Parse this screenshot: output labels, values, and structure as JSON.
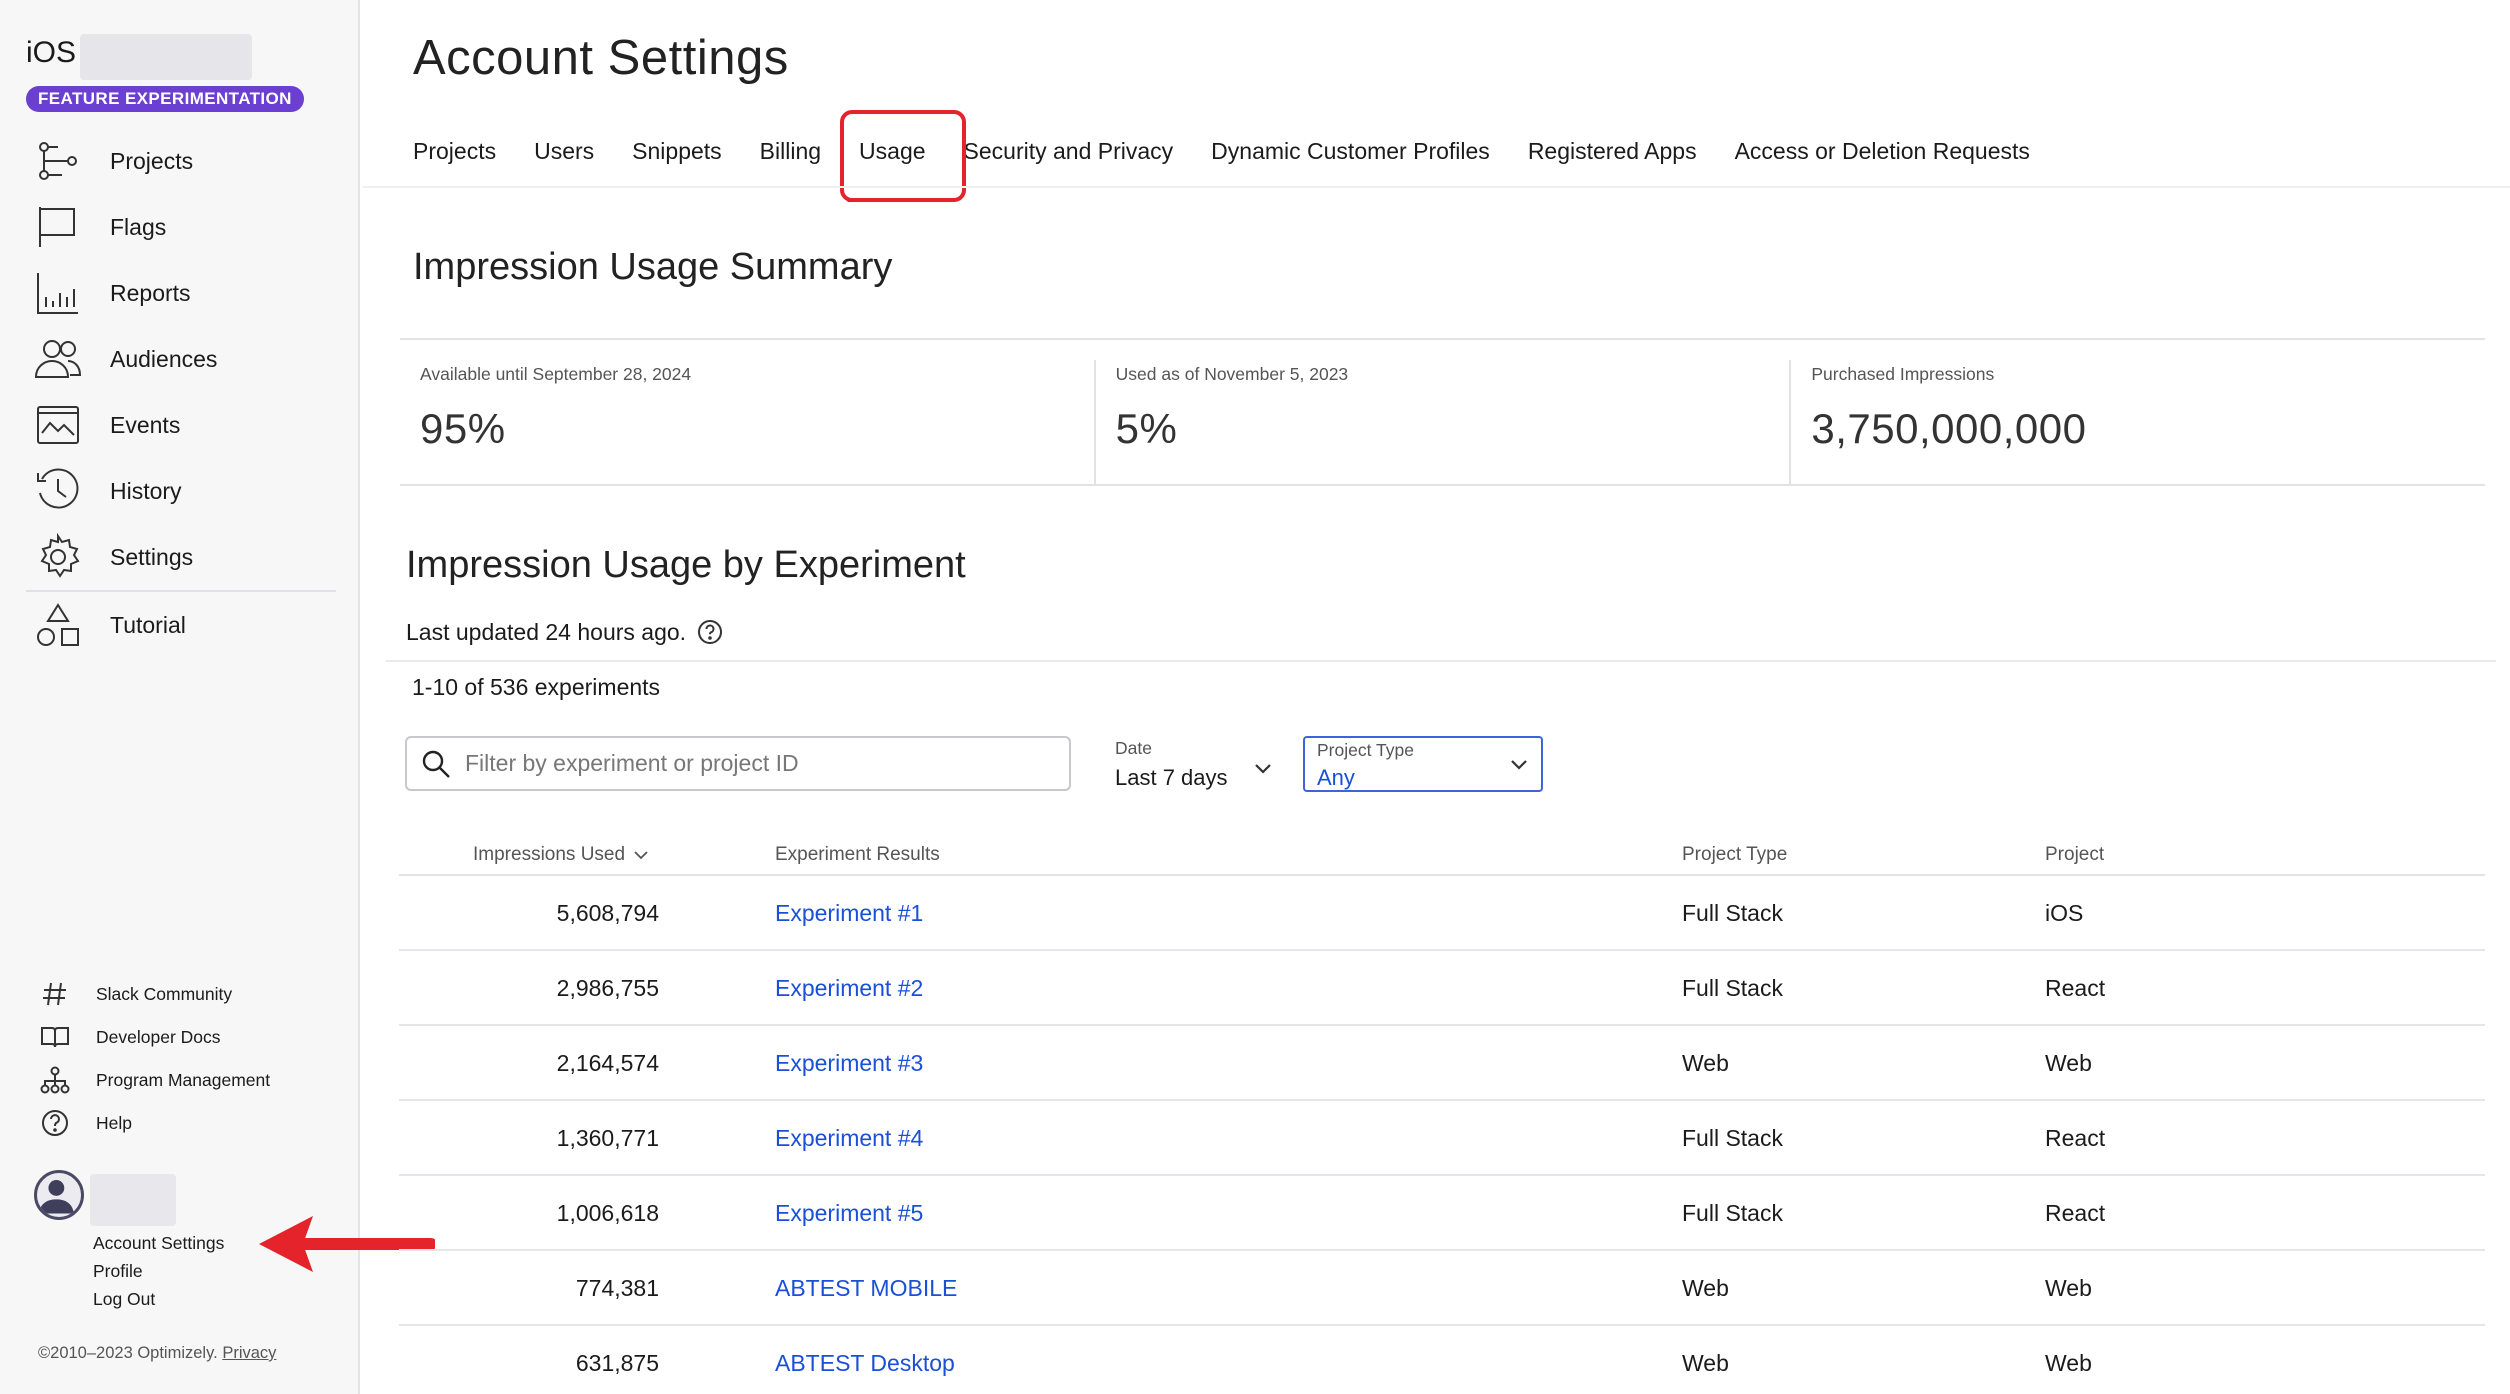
{
  "sidebar": {
    "project_name": "iOS",
    "badge": "FEATURE EXPERIMENTATION",
    "nav": [
      {
        "label": "Projects",
        "icon": "projects-icon"
      },
      {
        "label": "Flags",
        "icon": "flag-icon"
      },
      {
        "label": "Reports",
        "icon": "reports-icon"
      },
      {
        "label": "Audiences",
        "icon": "audiences-icon"
      },
      {
        "label": "Events",
        "icon": "events-icon"
      },
      {
        "label": "History",
        "icon": "history-icon"
      },
      {
        "label": "Settings",
        "icon": "gear-icon"
      },
      {
        "label": "Tutorial",
        "icon": "tutorial-icon"
      }
    ],
    "footer_links": [
      {
        "label": "Slack Community",
        "icon": "hash-icon"
      },
      {
        "label": "Developer Docs",
        "icon": "book-icon"
      },
      {
        "label": "Program Management",
        "icon": "org-chart-icon"
      },
      {
        "label": "Help",
        "icon": "help-icon"
      }
    ],
    "user_menu": [
      "Account Settings",
      "Profile",
      "Log Out"
    ],
    "copyright": "©2010–2023 Optimizely.",
    "privacy_link": "Privacy"
  },
  "header": {
    "title": "Account Settings",
    "tabs": [
      "Projects",
      "Users",
      "Snippets",
      "Billing",
      "Usage",
      "Security and Privacy",
      "Dynamic Customer Profiles",
      "Registered Apps",
      "Access or Deletion Requests"
    ],
    "active_tab": "Usage"
  },
  "summary": {
    "title": "Impression Usage Summary",
    "cells": [
      {
        "caption": "Available until September 28, 2024",
        "value": "95%"
      },
      {
        "caption": "Used as of November 5, 2023",
        "value": "5%"
      },
      {
        "caption": "Purchased Impressions",
        "value": "3,750,000,000"
      }
    ]
  },
  "by_experiment": {
    "title": "Impression Usage by Experiment",
    "last_updated": "Last updated 24 hours ago.",
    "count": "1-10 of 536 experiments",
    "search_placeholder": "Filter by experiment or project ID",
    "date_filter": {
      "caption": "Date",
      "value": "Last 7 days"
    },
    "project_type_filter": {
      "caption": "Project Type",
      "value": "Any"
    },
    "columns": [
      "Impressions Used",
      "Experiment Results",
      "Project Type",
      "Project"
    ],
    "rows": [
      {
        "impressions": "5,608,794",
        "experiment": "Experiment #1",
        "project_type": "Full Stack",
        "project": "iOS"
      },
      {
        "impressions": "2,986,755",
        "experiment": "Experiment #2",
        "project_type": "Full Stack",
        "project": "React"
      },
      {
        "impressions": "2,164,574",
        "experiment": "Experiment #3",
        "project_type": "Web",
        "project": "Web"
      },
      {
        "impressions": "1,360,771",
        "experiment": "Experiment #4",
        "project_type": "Full Stack",
        "project": "React"
      },
      {
        "impressions": "1,006,618",
        "experiment": "Experiment #5",
        "project_type": "Full Stack",
        "project": "React"
      },
      {
        "impressions": "774,381",
        "experiment": "ABTEST MOBILE",
        "project_type": "Web",
        "project": "Web"
      },
      {
        "impressions": "631,875",
        "experiment": "ABTEST Desktop",
        "project_type": "Web",
        "project": "Web"
      }
    ]
  },
  "colors": {
    "accent": "#0037ff",
    "link": "#1b4fd8",
    "badge": "#6b3fd1",
    "annotation": "#e4232b"
  }
}
